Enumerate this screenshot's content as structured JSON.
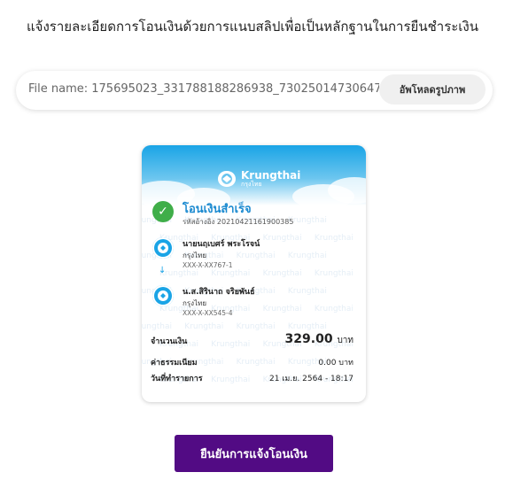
{
  "header": {
    "title": "แจ้งรายละเอียดการโอนเงินด้วยการแนบสลิปเพื่อเป็นหลักฐานในการยืนชำระเงิน"
  },
  "upload": {
    "file_name": "File name: 175695023_331788188286938_730250147306473",
    "upload_button": "อัพโหลดรูปภาพ"
  },
  "slip": {
    "brand_en": "Krungthai",
    "brand_th": "กรุงไทย",
    "watermark": "Krungthai",
    "status": "โอนเงินสำเร็จ",
    "reference": "รหัสอ้างอิง 20210421161900385",
    "sender": {
      "name": "นายนฤเบศร์ พระโรจน์",
      "bank": "กรุงไทย",
      "account": "XXX-X-XX767-1"
    },
    "receiver": {
      "name": "น.ส.สิรินาถ จริยพันธ์",
      "bank": "กรุงไทย",
      "account": "XXX-X-XX545-4"
    },
    "amount_label": "จำนวนเงิน",
    "amount_value": "329.00",
    "amount_unit": "บาท",
    "fee_label": "ค่าธรรมเนียม",
    "fee_value": "0.00 บาท",
    "date_label": "วันที่ทำรายการ",
    "date_value": "21 เม.ย. 2564 - 18:17",
    "colors": {
      "brand_blue": "#1aa4e6",
      "success_green": "#3fae49"
    }
  },
  "actions": {
    "confirm_button": "ยืนยันการแจ้งโอนเงิน",
    "confirm_color": "#520b84"
  }
}
